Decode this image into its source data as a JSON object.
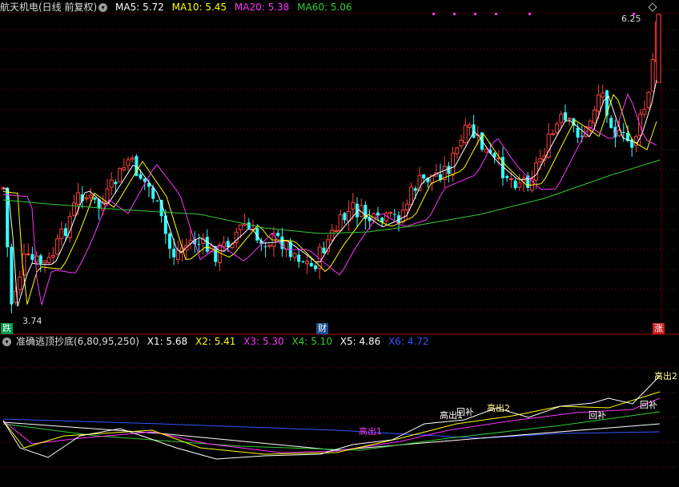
{
  "main_header": {
    "title": "航天机电(日线 前复权)",
    "ma": [
      {
        "label": "MA5: 5.72",
        "color": "#ffffff"
      },
      {
        "label": "MA10: 5.45",
        "color": "#ffff00"
      },
      {
        "label": "MA20: 5.38",
        "color": "#ff33ff"
      },
      {
        "label": "MA60: 5.06",
        "color": "#33cc33"
      }
    ]
  },
  "price_labels": {
    "high": "6.25",
    "low": "3.74"
  },
  "badges": [
    {
      "text": "跌",
      "bg": "#00994d",
      "color": "#ffffff"
    },
    {
      "text": "财",
      "bg": "#1b4d8c",
      "color": "#ffffff"
    },
    {
      "text": "涨",
      "bg": "#cc2222",
      "color": "#ffffff"
    }
  ],
  "indicator_header": {
    "title": "准确逃顶抄底(6,80,95,250)",
    "values": [
      {
        "label": "X1: 5.68",
        "color": "#ffffff"
      },
      {
        "label": "X2: 5.41",
        "color": "#ffff00"
      },
      {
        "label": "X3: 5.30",
        "color": "#ff33ff"
      },
      {
        "label": "X4: 5.10",
        "color": "#33cc33"
      },
      {
        "label": "X5: 4.86",
        "color": "#ffffff"
      },
      {
        "label": "X6: 4.72",
        "color": "#3355ff"
      }
    ]
  },
  "signals": [
    {
      "text": "高出1",
      "color": "#ff33ff"
    },
    {
      "text": "高出1",
      "color": "#ffffff"
    },
    {
      "text": "回补",
      "color": "#ffffff"
    },
    {
      "text": "高出2",
      "color": "#ffff88"
    },
    {
      "text": "回补",
      "color": "#ffffff"
    },
    {
      "text": "回补",
      "color": "#ffffff"
    },
    {
      "text": "高出2",
      "color": "#ffff88"
    }
  ],
  "colors": {
    "up": "#ff4040",
    "down": "#33ffff",
    "grid": "#7a1010",
    "divider": "#a00000"
  }
}
